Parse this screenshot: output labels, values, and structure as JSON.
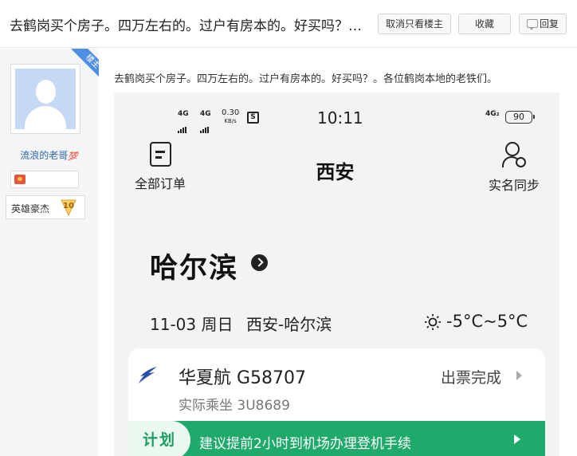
{
  "thread": {
    "title": "去鹤岗买个房子。四万左右的。过户有房本的。好买吗？。各位鹤岗本地的老铁们。",
    "buttons": {
      "only_op": "取消只看楼主",
      "favorite": "收藏",
      "reply": "回复"
    }
  },
  "user": {
    "op_badge": "楼主",
    "name": "流浪的老哥",
    "name_emoji": "💯",
    "level_name": "英雄豪杰",
    "level": "10"
  },
  "post": {
    "text": "去鹤岗买个房子。四万左右的。过户有房本的。好买吗？。各位鹤岗本地的老铁们。"
  },
  "phone": {
    "status": {
      "sig1": "4G",
      "sig2": "4G",
      "speed_value": "0.30",
      "speed_unit": "KB/s",
      "sim": "S",
      "time": "10:11",
      "sig_right": "4G₂",
      "battery": "90"
    },
    "nav": {
      "left": "全部订单",
      "title": "西安",
      "right": "实名同步"
    },
    "destination": "哈尔滨",
    "trip": {
      "date": "11-03 周日",
      "route": "西安-哈尔滨",
      "weather": "-5°C~5°C"
    },
    "flight": {
      "airline_flight": "华夏航 G58707",
      "status": "出票完成",
      "actual": "实际乘坐 3U8689"
    },
    "plan": {
      "tag": "计划",
      "text": "建议提前2小时到机场办理登机手续"
    }
  },
  "colors": {
    "accent_green": "#1faa6c",
    "link_blue": "#2d64b3",
    "op_ribbon": "#4e8fe2"
  },
  "icons": [
    "reply-icon",
    "medal-icon",
    "level-badge-icon",
    "doc-icon",
    "person-sync-icon",
    "arrow-right-icon",
    "sun-icon",
    "airline-logo-icon"
  ]
}
